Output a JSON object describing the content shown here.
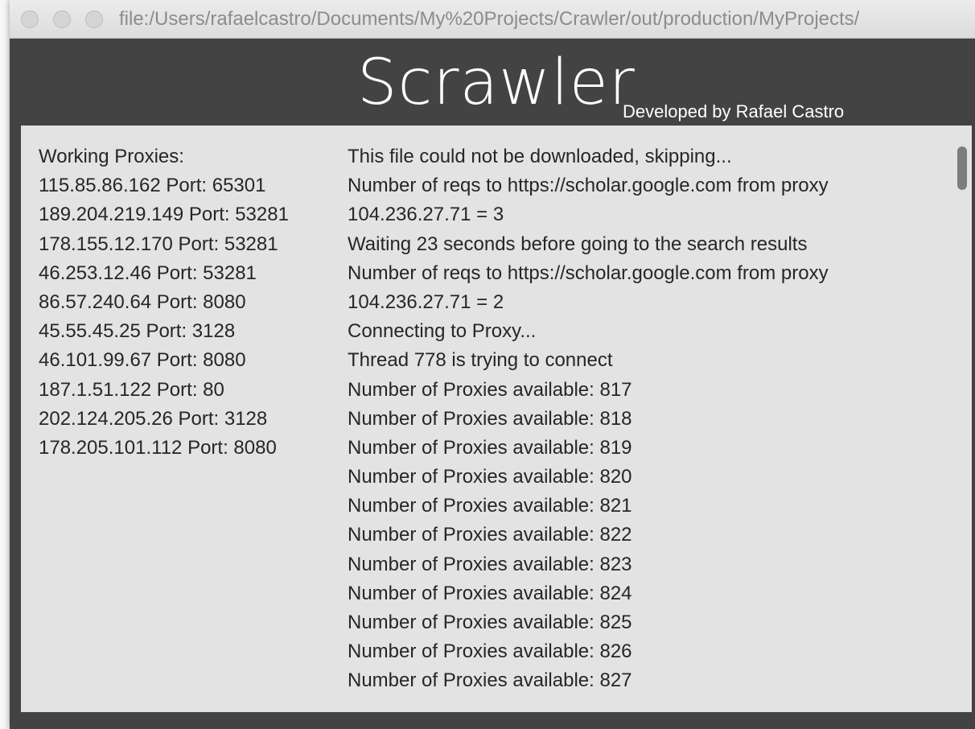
{
  "window": {
    "url": "file:/Users/rafaelcastro/Documents/My%20Projects/Crawler/out/production/MyProjects/"
  },
  "header": {
    "title": "Scrawler",
    "subtitle": "Developed by Rafael Castro"
  },
  "working_proxies": {
    "heading": "Working Proxies:",
    "items": [
      "115.85.86.162 Port: 65301",
      "189.204.219.149 Port: 53281",
      "178.155.12.170 Port: 53281",
      "46.253.12.46 Port: 53281",
      "86.57.240.64 Port: 8080",
      "45.55.45.25 Port: 3128",
      "46.101.99.67 Port: 8080",
      "187.1.51.122 Port: 80",
      "202.124.205.26 Port: 3128",
      "178.205.101.112 Port: 8080"
    ]
  },
  "log": {
    "lines": [
      "This file could not be downloaded, skipping...",
      "Number of reqs to https://scholar.google.com from proxy",
      "104.236.27.71 = 3",
      "Waiting 23 seconds before going to the search results",
      "Number of reqs to https://scholar.google.com from proxy",
      "104.236.27.71 = 2",
      "Connecting to Proxy...",
      "Thread 778 is trying to connect",
      "Number of Proxies available: 817",
      "Number of Proxies available: 818",
      "Number of Proxies available: 819",
      "Number of Proxies available: 820",
      "Number of Proxies available: 821",
      "Number of Proxies available: 822",
      "Number of Proxies available: 823",
      "Number of Proxies available: 824",
      "Number of Proxies available: 825",
      "Number of Proxies available: 826",
      "Number of Proxies available: 827"
    ]
  },
  "colors": {
    "window_bg": "#444344",
    "content_bg": "#e4e3e4",
    "text": "#262626",
    "header_text": "#ffffff"
  }
}
